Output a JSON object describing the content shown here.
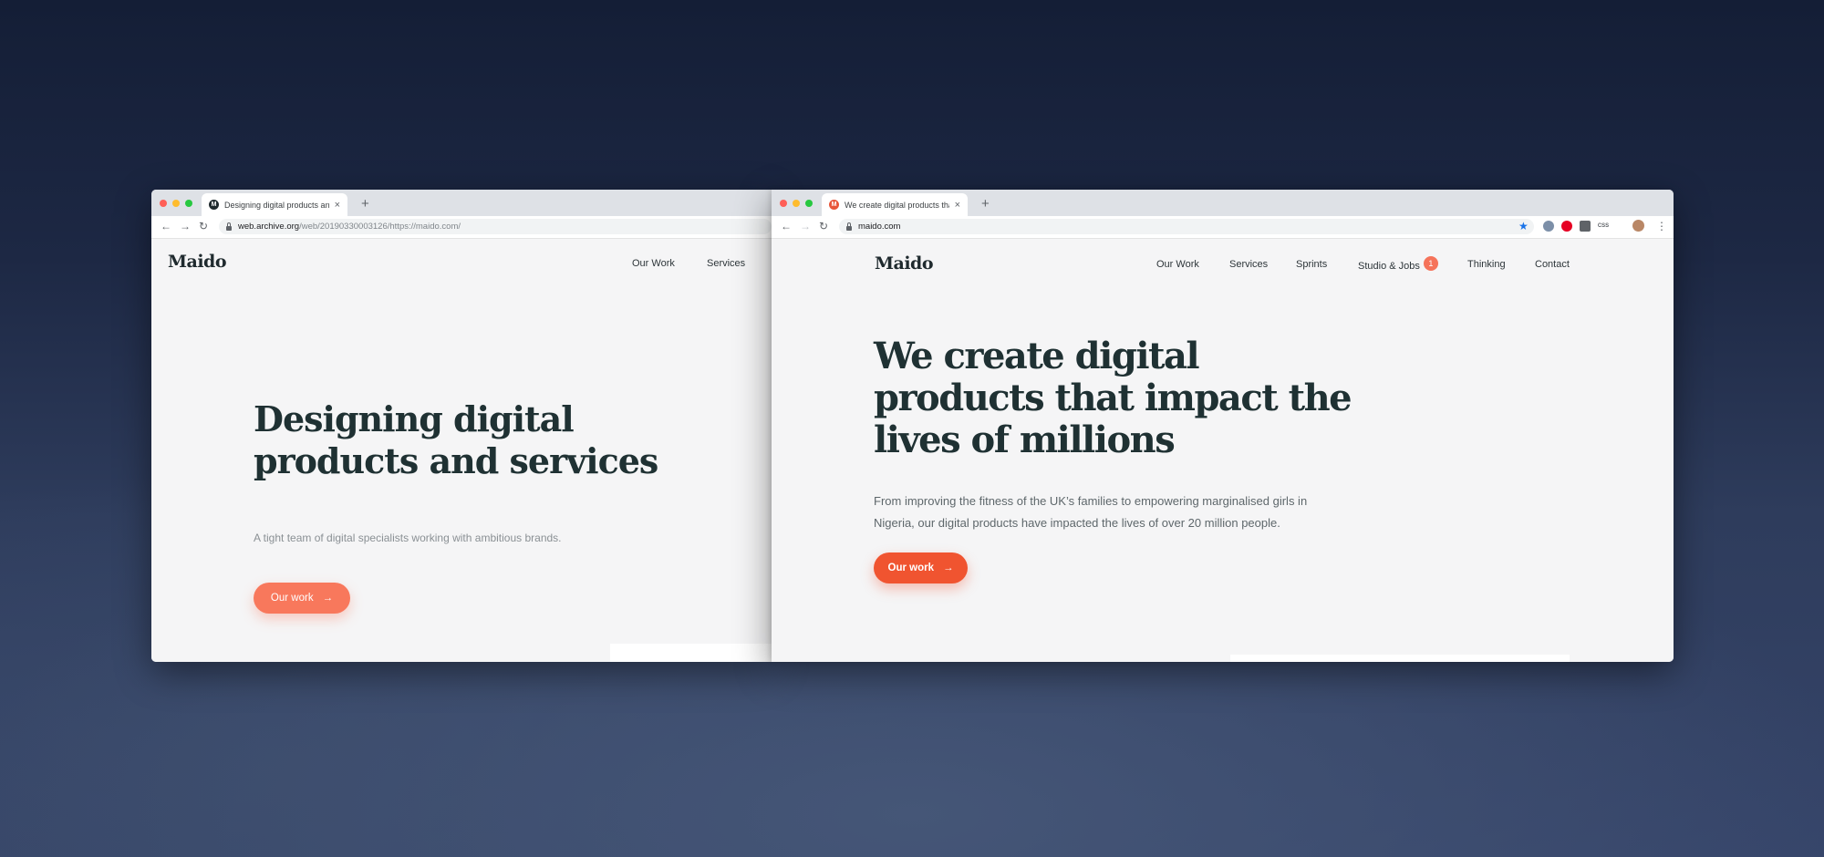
{
  "left_window": {
    "tab": {
      "title": "Designing digital products and services",
      "favicon": "M",
      "close": "×"
    },
    "new_tab": "+",
    "nav_icons": {
      "back": "←",
      "forward": "→",
      "reload": "↻"
    },
    "url_host": "web.archive.org",
    "url_path": "/web/20190330003126/https://maido.com/",
    "site": {
      "logo": "Maido",
      "nav": [
        "Our Work",
        "Services"
      ],
      "headline_line1": "Designing digital",
      "headline_line2": "products and services",
      "subtitle": "A tight team of digital specialists working with ambitious brands.",
      "cta": "Our work",
      "cta_arrow": "→"
    }
  },
  "right_window": {
    "tab": {
      "title": "We create digital products that impact the lives of millions",
      "favicon": "M",
      "close": "×"
    },
    "new_tab": "+",
    "nav_icons": {
      "back": "←",
      "forward": "→",
      "reload": "↻",
      "bookmark": "★",
      "menu": "⋮"
    },
    "url": "maido.com",
    "extensions": [
      "extension-icon",
      "pinterest-icon",
      "grid-icon",
      "css-icon"
    ],
    "extension_css_label": "CSS",
    "site": {
      "logo": "Maido",
      "nav": {
        "our_work": "Our Work",
        "services": "Services",
        "sprints": "Sprints",
        "studio_jobs": "Studio & Jobs",
        "studio_jobs_badge": "1",
        "thinking": "Thinking",
        "contact": "Contact"
      },
      "headline_line1": "We create digital",
      "headline_line2": "products that impact the",
      "headline_line3": "lives of millions",
      "body_line1": "From improving the fitness of the UK’s families to empowering marginalised girls in",
      "body_line2": "Nigeria, our digital products have impacted the lives of over 20 million people.",
      "cta": "Our work",
      "cta_arrow": "→"
    }
  },
  "colors": {
    "left_cta": "#f8785c",
    "right_cta": "#f05430",
    "headline": "#1f3133",
    "badge": "#f5735a",
    "traffic_red": "#ff5f57",
    "traffic_yellow": "#febc2e",
    "traffic_green": "#28c840"
  }
}
